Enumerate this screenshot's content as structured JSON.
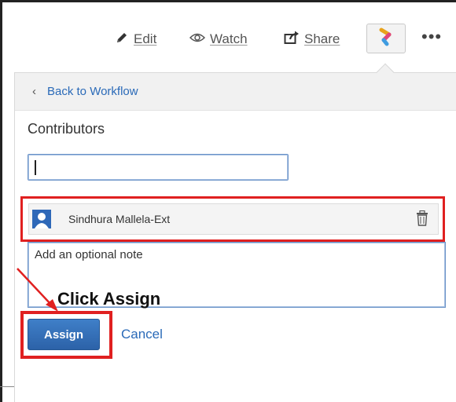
{
  "toolbar": {
    "edit_label": "Edit",
    "watch_label": "Watch",
    "share_label": "Share",
    "more_label": "•••"
  },
  "panel": {
    "back_label": "Back to Workflow",
    "section_title": "Contributors",
    "contributor_input_value": "",
    "selected_user": {
      "name": "Sindhura Mallela-Ext"
    },
    "note_placeholder": "Add an optional note",
    "assign_label": "Assign",
    "cancel_label": "Cancel"
  },
  "annotation": {
    "text": "Click Assign",
    "highlight_color": "#e02020"
  },
  "colors": {
    "link": "#2a6ab8",
    "primary_button": "#2c62a8"
  }
}
